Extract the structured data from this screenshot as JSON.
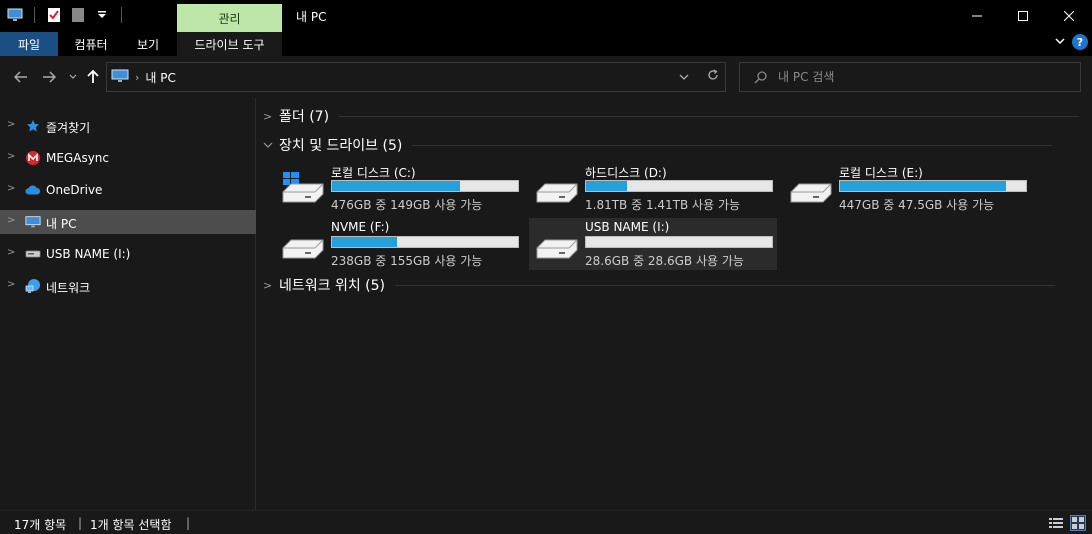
{
  "titlebar": {
    "context_tab": "관리",
    "title": "내 PC"
  },
  "ribbon": {
    "tabs": [
      "파일",
      "컴퓨터",
      "보기",
      "드라이브 도구"
    ],
    "help": "?"
  },
  "address": {
    "crumb": "내 PC",
    "search_placeholder": "내 PC 검색"
  },
  "sidebar": {
    "items": [
      {
        "label": "즐겨찾기",
        "icon": "star-icon"
      },
      {
        "label": "MEGAsync",
        "icon": "mega-icon"
      },
      {
        "label": "OneDrive",
        "icon": "cloud-icon"
      },
      {
        "label": "내 PC",
        "icon": "computer-icon"
      },
      {
        "label": "USB NAME (I:)",
        "icon": "usb-drive-icon"
      },
      {
        "label": "네트워크",
        "icon": "network-icon"
      }
    ]
  },
  "groups": {
    "folders": "폴더 (7)",
    "devices": "장치 및 드라이브 (5)",
    "network": "네트워크 위치 (5)"
  },
  "drives": [
    {
      "name": "로컬 디스크 (C:)",
      "free_text": "476GB 중 149GB 사용 가능",
      "used_fraction": 0.69,
      "windows": true
    },
    {
      "name": "하드디스크 (D:)",
      "free_text": "1.81TB 중 1.41TB 사용 가능",
      "used_fraction": 0.22,
      "windows": false
    },
    {
      "name": "로컬 디스크 (E:)",
      "free_text": "447GB 중 47.5GB 사용 가능",
      "used_fraction": 0.89,
      "windows": false
    },
    {
      "name": "NVME (F:)",
      "free_text": "238GB 중 155GB 사용 가능",
      "used_fraction": 0.35,
      "windows": false
    },
    {
      "name": "USB NAME (I:)",
      "free_text": "28.6GB 중 28.6GB 사용 가능",
      "used_fraction": 0.0,
      "windows": false
    }
  ],
  "status": {
    "items_count": "17개 항목",
    "selected": "1개 항목 선택함"
  },
  "colors": {
    "accent": "#26a0da",
    "file_tab": "#1b4e82",
    "context_tab": "#bde7a8"
  }
}
